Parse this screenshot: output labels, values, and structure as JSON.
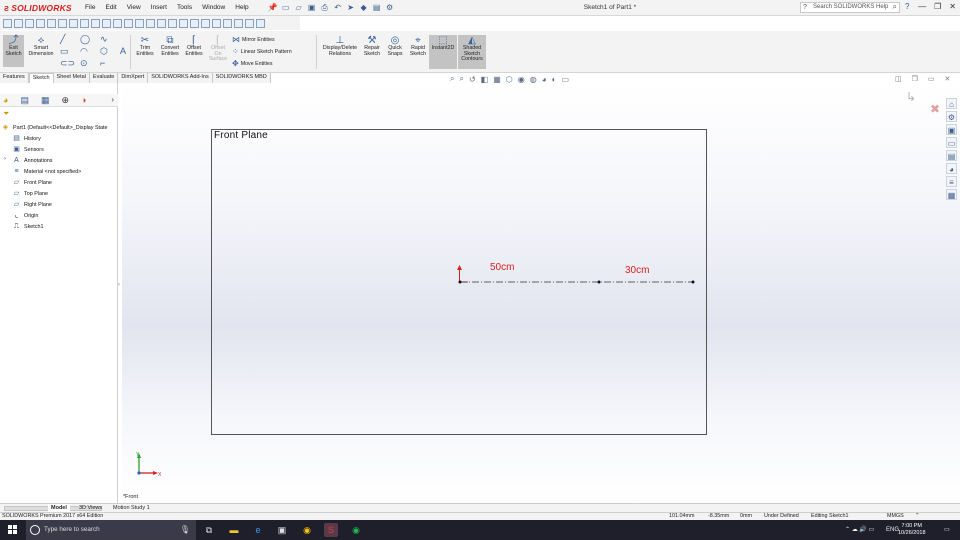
{
  "app": {
    "brand": "SOLIDWORKS",
    "doc_title": "Sketch1 of Part1 *",
    "menus": [
      "File",
      "Edit",
      "View",
      "Insert",
      "Tools",
      "Window",
      "Help"
    ],
    "search_placeholder": "Search SOLIDWORKS Help"
  },
  "commands": {
    "exit_sketch": "Exit Sketch",
    "smart_dimension": "Smart Dimension",
    "trim_entities": "Trim Entities",
    "convert_entities": "Convert Entities",
    "offset_entities": "Offset Entities",
    "offset_on_surface": "Offset On Surface",
    "mirror_entities": "Mirror Entities",
    "linear_sketch_pattern": "Linear Sketch Pattern",
    "move_entities": "Move Entities",
    "display_delete_relations": "Display/Delete Relations",
    "repair_sketch": "Repair Sketch",
    "quick_snaps": "Quick Snaps",
    "rapid_sketch": "Rapid Sketch",
    "instant2d": "Instant2D",
    "shaded_sketch_contours": "Shaded Sketch Contours"
  },
  "tabs": [
    "Features",
    "Sketch",
    "Sheet Metal",
    "Evaluate",
    "DimXpert",
    "SOLIDWORKS Add-Ins",
    "SOLIDWORKS MBD"
  ],
  "active_tab": "Sketch",
  "tree": {
    "root": "Part1  (Default<<Default>_Display State",
    "items": [
      "History",
      "Sensors",
      "Annotations",
      "Material <not specified>",
      "Front Plane",
      "Top Plane",
      "Right Plane",
      "Origin",
      "Sketch1"
    ]
  },
  "graphics": {
    "plane_label": "Front Plane",
    "dim1": "50cm",
    "dim2": "30cm",
    "view_label": "*Front"
  },
  "bottom_tabs": [
    "Model",
    "3D Views",
    "Motion Study 1"
  ],
  "status": {
    "edition": "SOLIDWORKS Premium 2017 x64 Edition",
    "x": "101.04mm",
    "y": "-8.35mm",
    "z": "0mm",
    "state": "Under Defined",
    "editing": "Editing Sketch1",
    "units": "MMGS"
  },
  "taskbar": {
    "search_placeholder": "Type here to search",
    "lang": "ENG",
    "time": "7:00 PM",
    "date": "10/26/2018"
  }
}
